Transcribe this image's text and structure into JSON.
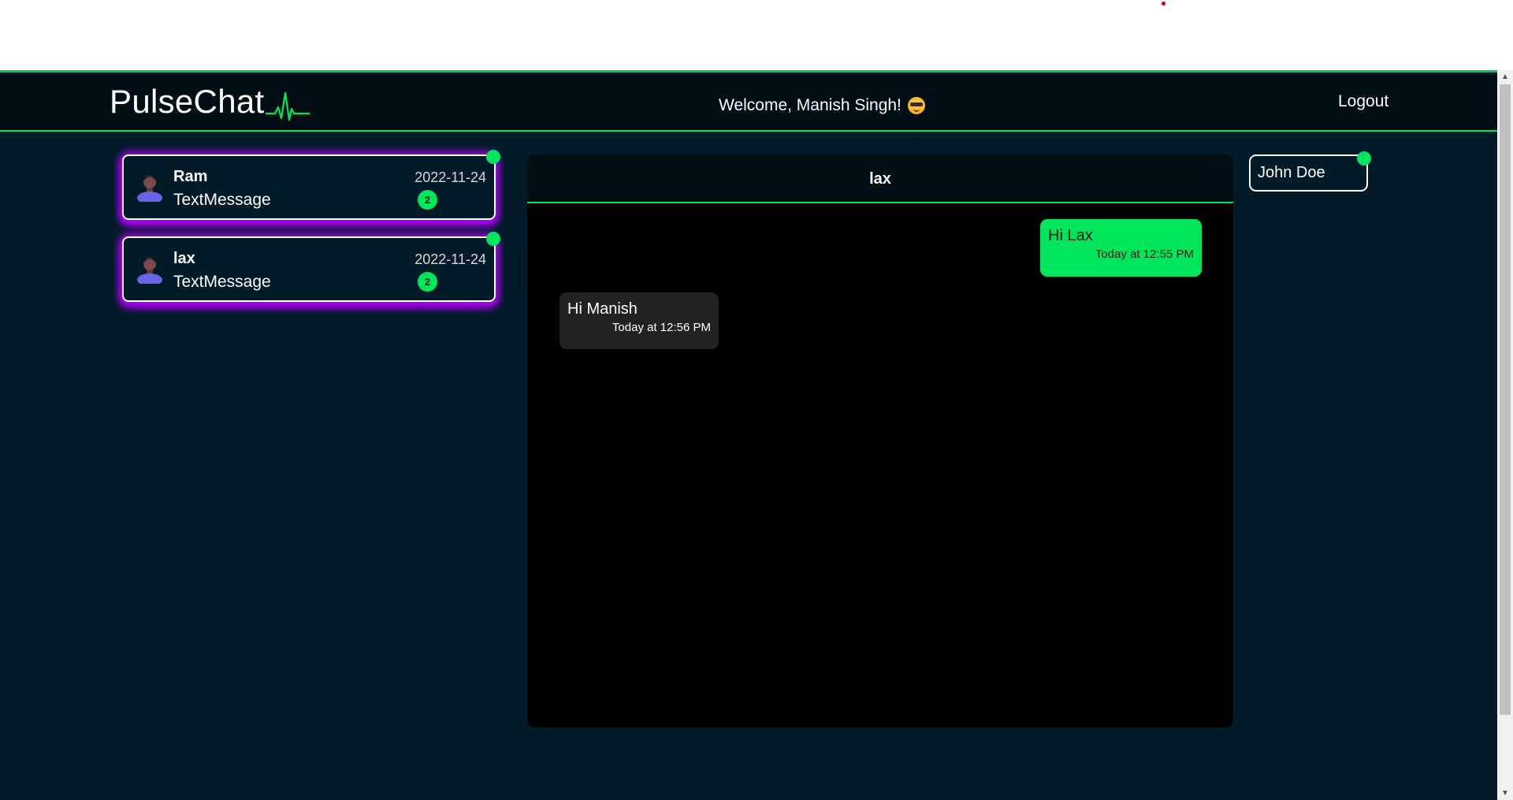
{
  "navbar": {
    "brand": "PulseChat",
    "welcome": "Welcome, Manish Singh!",
    "welcome_emoji_icon": "sunglasses-emoji-icon",
    "logout_label": "Logout"
  },
  "contacts": [
    {
      "name": "Ram",
      "last_message": "TextMessage",
      "date": "2022-11-24",
      "unread": "2",
      "online": true
    },
    {
      "name": "lax",
      "last_message": "TextMessage",
      "date": "2022-11-24",
      "unread": "2",
      "online": true
    }
  ],
  "chat": {
    "title": "lax",
    "messages": [
      {
        "direction": "outgoing",
        "text": "Hi Lax",
        "time": "Today at 12:55 PM"
      },
      {
        "direction": "incoming",
        "text": "Hi Manish",
        "time": "Today at 12:56 PM"
      }
    ]
  },
  "online_users": [
    {
      "name": "John Doe",
      "online": true
    }
  ],
  "colors": {
    "accent": "#00e65c",
    "background": "#011b29",
    "navbar": "#010e13",
    "chat_panel": "#000000",
    "glow": "#b500ff",
    "incoming_bubble": "#222222"
  }
}
